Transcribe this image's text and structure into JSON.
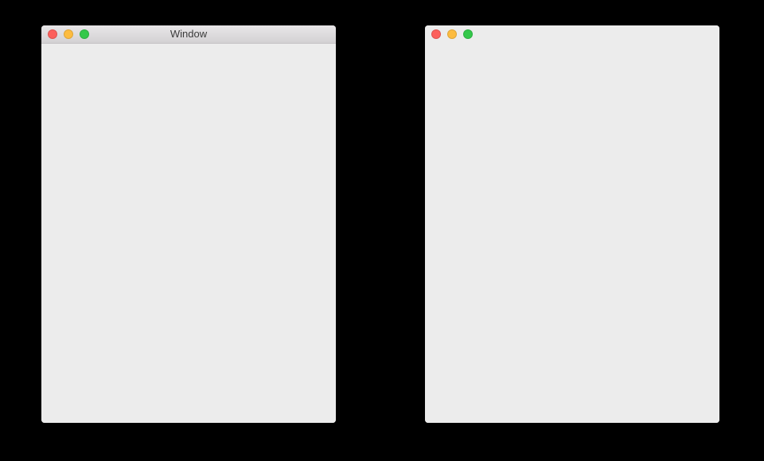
{
  "colors": {
    "desktop": "#000000",
    "window_background": "#ececec",
    "close": "#fc605c",
    "minimize": "#fdbc40",
    "zoom": "#34c84a"
  },
  "windows": [
    {
      "title": "Window",
      "titlebar_style": "standard",
      "buttons": [
        {
          "role": "close",
          "icon": "close-icon"
        },
        {
          "role": "minimize",
          "icon": "minimize-icon"
        },
        {
          "role": "zoom",
          "icon": "zoom-icon"
        }
      ]
    },
    {
      "title": "",
      "titlebar_style": "hidden-transparent",
      "buttons": [
        {
          "role": "close",
          "icon": "close-icon"
        },
        {
          "role": "minimize",
          "icon": "minimize-icon"
        },
        {
          "role": "zoom",
          "icon": "zoom-icon"
        }
      ]
    }
  ]
}
